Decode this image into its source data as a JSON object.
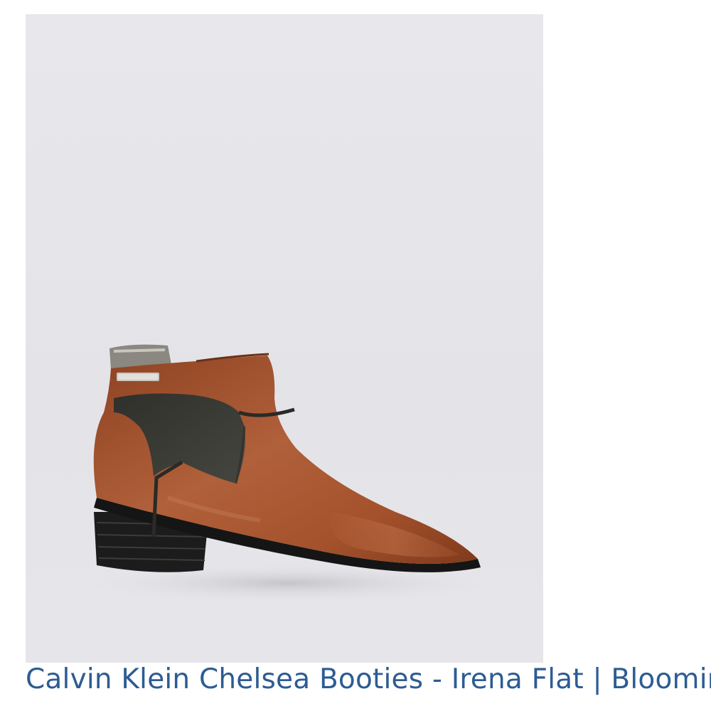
{
  "product": {
    "title_link": "Calvin Klein Chelsea Booties - Irena Flat | Bloomingdale's",
    "image": {
      "icon": "ankle-boot-photo",
      "colors": {
        "background": "#e6e6ea",
        "leather": "#a4522c",
        "panel": "#3a3a34",
        "sole": "#1c1c1c"
      }
    }
  },
  "colors": {
    "link": "#2d5c93",
    "page_background": "#ffffff"
  }
}
